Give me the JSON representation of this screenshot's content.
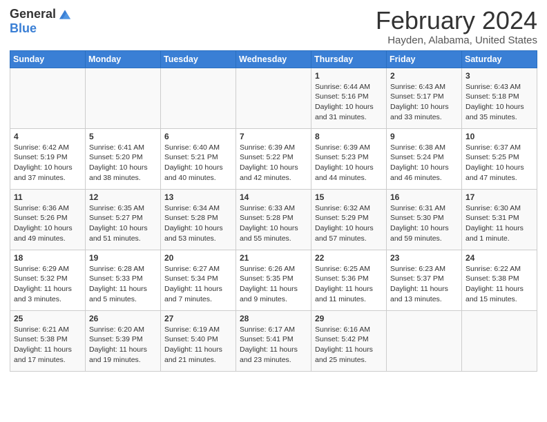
{
  "header": {
    "logo_general": "General",
    "logo_blue": "Blue",
    "title": "February 2024",
    "subtitle": "Hayden, Alabama, United States"
  },
  "weekdays": [
    "Sunday",
    "Monday",
    "Tuesday",
    "Wednesday",
    "Thursday",
    "Friday",
    "Saturday"
  ],
  "weeks": [
    [
      {
        "day": "",
        "info": ""
      },
      {
        "day": "",
        "info": ""
      },
      {
        "day": "",
        "info": ""
      },
      {
        "day": "",
        "info": ""
      },
      {
        "day": "1",
        "info": "Sunrise: 6:44 AM\nSunset: 5:16 PM\nDaylight: 10 hours\nand 31 minutes."
      },
      {
        "day": "2",
        "info": "Sunrise: 6:43 AM\nSunset: 5:17 PM\nDaylight: 10 hours\nand 33 minutes."
      },
      {
        "day": "3",
        "info": "Sunrise: 6:43 AM\nSunset: 5:18 PM\nDaylight: 10 hours\nand 35 minutes."
      }
    ],
    [
      {
        "day": "4",
        "info": "Sunrise: 6:42 AM\nSunset: 5:19 PM\nDaylight: 10 hours\nand 37 minutes."
      },
      {
        "day": "5",
        "info": "Sunrise: 6:41 AM\nSunset: 5:20 PM\nDaylight: 10 hours\nand 38 minutes."
      },
      {
        "day": "6",
        "info": "Sunrise: 6:40 AM\nSunset: 5:21 PM\nDaylight: 10 hours\nand 40 minutes."
      },
      {
        "day": "7",
        "info": "Sunrise: 6:39 AM\nSunset: 5:22 PM\nDaylight: 10 hours\nand 42 minutes."
      },
      {
        "day": "8",
        "info": "Sunrise: 6:39 AM\nSunset: 5:23 PM\nDaylight: 10 hours\nand 44 minutes."
      },
      {
        "day": "9",
        "info": "Sunrise: 6:38 AM\nSunset: 5:24 PM\nDaylight: 10 hours\nand 46 minutes."
      },
      {
        "day": "10",
        "info": "Sunrise: 6:37 AM\nSunset: 5:25 PM\nDaylight: 10 hours\nand 47 minutes."
      }
    ],
    [
      {
        "day": "11",
        "info": "Sunrise: 6:36 AM\nSunset: 5:26 PM\nDaylight: 10 hours\nand 49 minutes."
      },
      {
        "day": "12",
        "info": "Sunrise: 6:35 AM\nSunset: 5:27 PM\nDaylight: 10 hours\nand 51 minutes."
      },
      {
        "day": "13",
        "info": "Sunrise: 6:34 AM\nSunset: 5:28 PM\nDaylight: 10 hours\nand 53 minutes."
      },
      {
        "day": "14",
        "info": "Sunrise: 6:33 AM\nSunset: 5:28 PM\nDaylight: 10 hours\nand 55 minutes."
      },
      {
        "day": "15",
        "info": "Sunrise: 6:32 AM\nSunset: 5:29 PM\nDaylight: 10 hours\nand 57 minutes."
      },
      {
        "day": "16",
        "info": "Sunrise: 6:31 AM\nSunset: 5:30 PM\nDaylight: 10 hours\nand 59 minutes."
      },
      {
        "day": "17",
        "info": "Sunrise: 6:30 AM\nSunset: 5:31 PM\nDaylight: 11 hours\nand 1 minute."
      }
    ],
    [
      {
        "day": "18",
        "info": "Sunrise: 6:29 AM\nSunset: 5:32 PM\nDaylight: 11 hours\nand 3 minutes."
      },
      {
        "day": "19",
        "info": "Sunrise: 6:28 AM\nSunset: 5:33 PM\nDaylight: 11 hours\nand 5 minutes."
      },
      {
        "day": "20",
        "info": "Sunrise: 6:27 AM\nSunset: 5:34 PM\nDaylight: 11 hours\nand 7 minutes."
      },
      {
        "day": "21",
        "info": "Sunrise: 6:26 AM\nSunset: 5:35 PM\nDaylight: 11 hours\nand 9 minutes."
      },
      {
        "day": "22",
        "info": "Sunrise: 6:25 AM\nSunset: 5:36 PM\nDaylight: 11 hours\nand 11 minutes."
      },
      {
        "day": "23",
        "info": "Sunrise: 6:23 AM\nSunset: 5:37 PM\nDaylight: 11 hours\nand 13 minutes."
      },
      {
        "day": "24",
        "info": "Sunrise: 6:22 AM\nSunset: 5:38 PM\nDaylight: 11 hours\nand 15 minutes."
      }
    ],
    [
      {
        "day": "25",
        "info": "Sunrise: 6:21 AM\nSunset: 5:38 PM\nDaylight: 11 hours\nand 17 minutes."
      },
      {
        "day": "26",
        "info": "Sunrise: 6:20 AM\nSunset: 5:39 PM\nDaylight: 11 hours\nand 19 minutes."
      },
      {
        "day": "27",
        "info": "Sunrise: 6:19 AM\nSunset: 5:40 PM\nDaylight: 11 hours\nand 21 minutes."
      },
      {
        "day": "28",
        "info": "Sunrise: 6:17 AM\nSunset: 5:41 PM\nDaylight: 11 hours\nand 23 minutes."
      },
      {
        "day": "29",
        "info": "Sunrise: 6:16 AM\nSunset: 5:42 PM\nDaylight: 11 hours\nand 25 minutes."
      },
      {
        "day": "",
        "info": ""
      },
      {
        "day": "",
        "info": ""
      }
    ]
  ]
}
